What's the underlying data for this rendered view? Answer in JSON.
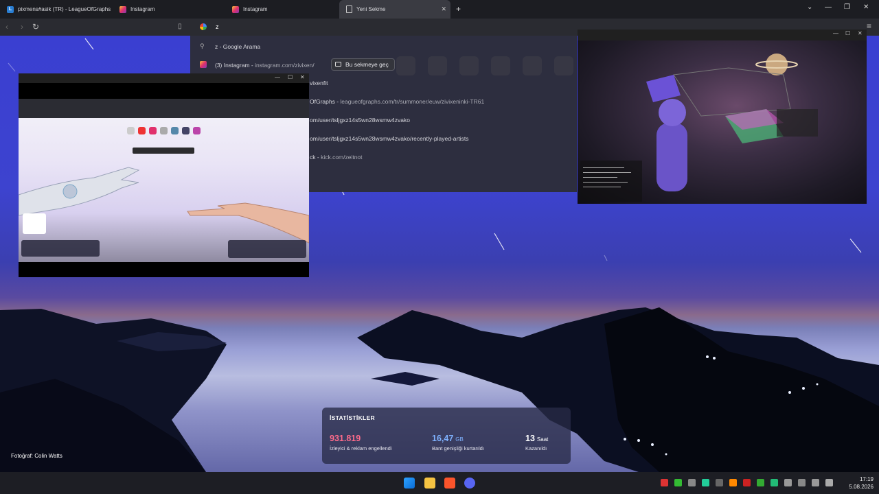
{
  "tabs": [
    {
      "label": "pixmens#asik (TR) - LeagueOfGraphs",
      "icon": "leagueofgraphs-icon"
    },
    {
      "label": "Instagram",
      "icon": "instagram-icon"
    },
    {
      "label": "Instagram",
      "icon": "instagram-icon"
    },
    {
      "label": "Yeni Sekme",
      "icon": "new-tab-page-icon"
    }
  ],
  "omnibox": {
    "value": "z"
  },
  "suggestions": [
    {
      "title": "z - Google Arama",
      "url": ""
    },
    {
      "title": "(3) Instagram",
      "url": "instagram.com/zivixen/",
      "switch_label": "Bu sekmeye geç"
    },
    {
      "title": "",
      "url": "vixenfit"
    },
    {
      "title": "OfGraphs",
      "url": "leagueofgraphs.com/tr/summoner/euw/zivixeninki-TR61"
    },
    {
      "title": "",
      "url": "om/user/tsljgxz14s5wn28wsmw4zvako"
    },
    {
      "title": "",
      "url": "om/user/tsljgxz14s5wn28wsmw4zvako/recently-played-artists"
    },
    {
      "title": "ck",
      "url": "kick.com/zeitnot"
    }
  ],
  "stats": {
    "title": "İSTATİSTİKLER",
    "items": [
      {
        "value": "931.819",
        "unit": "",
        "label": "İzleyici & reklam engellendi",
        "color": "#ff6b8b"
      },
      {
        "value": "16,47",
        "unit": "GB",
        "label": "Bant genişliği kurtarıldı",
        "color": "#7fb2ff"
      },
      {
        "value": "13",
        "unit": "Saat",
        "label": "Kazanıldı",
        "color": "#ffffff"
      }
    ]
  },
  "photo_credit": "Fotoğraf: Colin Watts",
  "clock": {
    "time": "17:19",
    "date": "5.08.2026"
  },
  "colors": {
    "accent_pink": "#ff6b8b",
    "accent_blue": "#7fb2ff",
    "brave_orange": "#fb542b",
    "discord": "#5865f2"
  }
}
